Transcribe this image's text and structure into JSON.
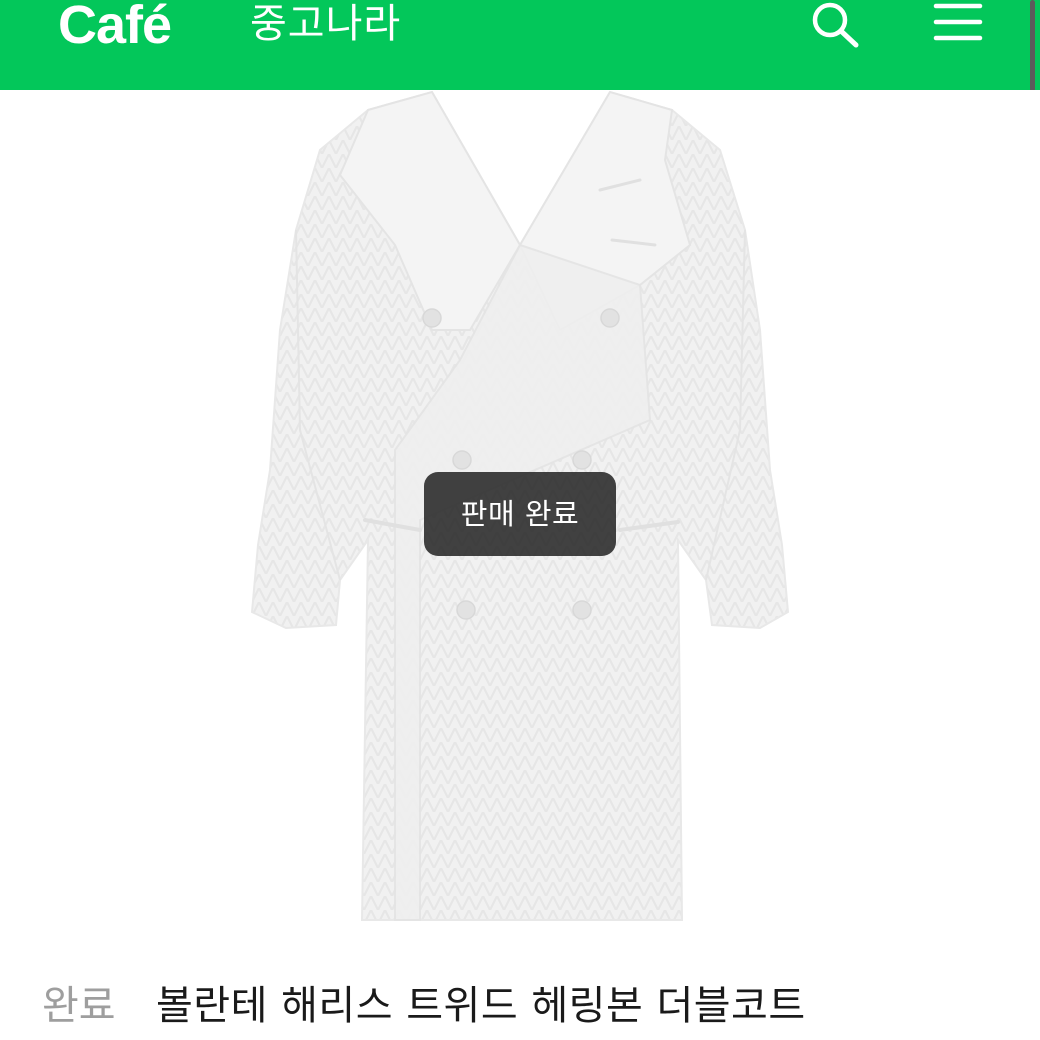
{
  "header": {
    "logo": "Café",
    "cafe_name": "중고나라",
    "icons": [
      "search-icon",
      "menu-icon"
    ],
    "brand_color": "#03c75a"
  },
  "product": {
    "image_subject": "coat-image",
    "status_badge": "판매 완료",
    "status_label": "완료",
    "title": "볼란테 해리스 트위드 헤링본 더블코트"
  }
}
